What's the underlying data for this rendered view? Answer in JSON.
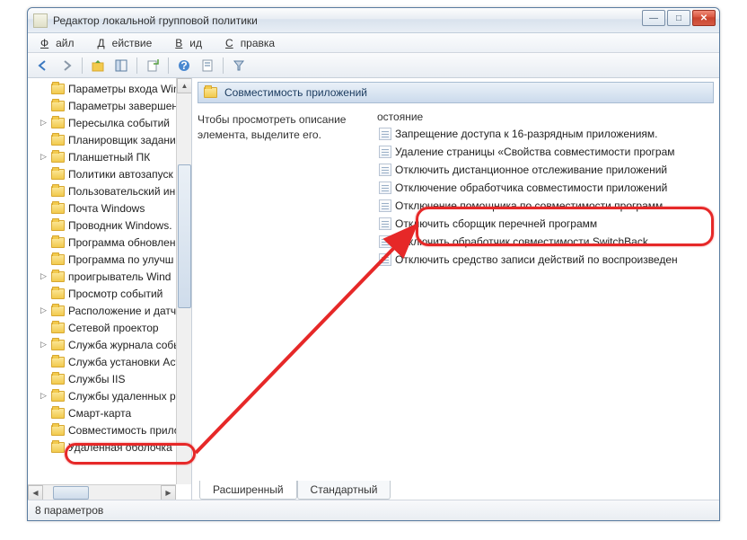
{
  "window": {
    "title": "Редактор локальной групповой политики"
  },
  "menu": {
    "file": "Файл",
    "action": "Действие",
    "view": "Вид",
    "help": "Справка"
  },
  "tree": {
    "items": [
      {
        "label": "Параметры входа Wind",
        "arrow": false
      },
      {
        "label": "Параметры завершени",
        "arrow": false
      },
      {
        "label": "Пересылка событий",
        "arrow": true
      },
      {
        "label": "Планировщик задани",
        "arrow": false
      },
      {
        "label": "Планшетный ПК",
        "arrow": true
      },
      {
        "label": "Политики автозапуск",
        "arrow": false
      },
      {
        "label": "Пользовательский ин",
        "arrow": false
      },
      {
        "label": "Почта Windows",
        "arrow": false
      },
      {
        "label": "Проводник Windows.",
        "arrow": false
      },
      {
        "label": "Программа обновлен",
        "arrow": false
      },
      {
        "label": "Программа по улучш",
        "arrow": false
      },
      {
        "label": "проигрыватель Wind",
        "arrow": true
      },
      {
        "label": "Просмотр событий",
        "arrow": false
      },
      {
        "label": "Расположение и датч",
        "arrow": true
      },
      {
        "label": "Сетевой проектор",
        "arrow": false
      },
      {
        "label": "Служба журнала собы",
        "arrow": true
      },
      {
        "label": "Служба установки Act",
        "arrow": false
      },
      {
        "label": "Службы IIS",
        "arrow": false
      },
      {
        "label": "Службы удаленных ра",
        "arrow": true
      },
      {
        "label": "Смарт-карта",
        "arrow": false
      },
      {
        "label": "Совместимость прило",
        "arrow": false,
        "selected": true
      },
      {
        "label": "Удаленная оболочка W",
        "arrow": false
      }
    ]
  },
  "right": {
    "header": "Совместимость приложений",
    "desc": "Чтобы просмотреть описание элемента, выделите его.",
    "col_header": "остояние",
    "policies": [
      "Запрещение доступа к 16-разрядным приложениям.",
      "Удаление страницы «Свойства совместимости програм",
      "Отключить дистанционное отслеживание приложений",
      "Отключение обработчика совместимости приложений",
      "Отключение помощника по совместимости программ",
      "Отключить сборщик перечней программ",
      "Отключить обработчик совместимости SwitchBack",
      "Отключить средство записи действий по воспроизведен"
    ]
  },
  "tabs": {
    "extended": "Расширенный",
    "standard": "Стандартный"
  },
  "status": "8 параметров"
}
